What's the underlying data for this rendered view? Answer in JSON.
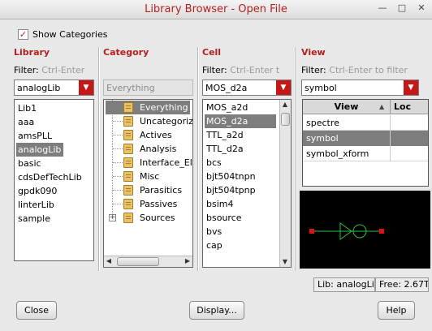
{
  "window": {
    "title": "Library Browser - Open File"
  },
  "titlebar_icons": [
    "minimize-icon",
    "maximize-icon",
    "close-icon"
  ],
  "show_categories": {
    "label": "Show Categories",
    "checked": true
  },
  "library": {
    "title": "Library",
    "filter_label": "Filter:",
    "filter_placeholder": "Ctrl-Enter",
    "selected": "analogLib",
    "items": [
      "Lib1",
      "aaa",
      "amsPLL",
      "analogLib",
      "basic",
      "cdsDefTechLib",
      "gpdk090",
      "linterLib",
      "sample"
    ]
  },
  "category": {
    "title": "Category",
    "selected": "Everything",
    "items": [
      "Everything",
      "Uncategoriz",
      "Actives",
      "Analysis",
      "Interface_Ele",
      "Misc",
      "Parasitics",
      "Passives",
      "Sources"
    ]
  },
  "cell": {
    "title": "Cell",
    "filter_label": "Filter:",
    "filter_placeholder": "Ctrl-Enter t",
    "selected": "MOS_d2a",
    "items": [
      "MOS_a2d",
      "MOS_d2a",
      "TTL_a2d",
      "TTL_d2a",
      "bcs",
      "bjt504tnpn",
      "bjt504tpnp",
      "bsim4",
      "bsource",
      "bvs",
      "cap"
    ]
  },
  "view": {
    "title": "View",
    "filter_label": "Filter:",
    "filter_placeholder": "Ctrl-Enter to filter",
    "selected": "symbol",
    "headers": [
      "View",
      "Loc"
    ],
    "rows": [
      "spectre",
      "symbol",
      "symbol_xform"
    ]
  },
  "status": {
    "lib": "Lib: analogLib",
    "free": "Free: 2.67T"
  },
  "buttons": {
    "close": "Close",
    "display": "Display...",
    "help": "Help"
  },
  "colors": {
    "accent": "#c41818",
    "selection": "#7d7d7d",
    "preview_bg": "#000000",
    "preview_line": "#2fbf3a",
    "preview_pin": "#e01010"
  }
}
